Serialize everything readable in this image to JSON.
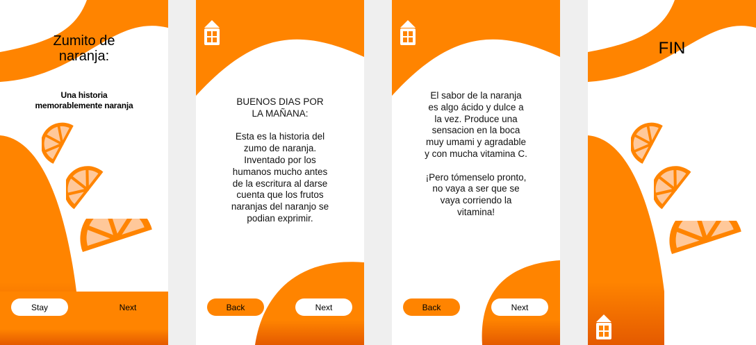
{
  "colors": {
    "accent": "#ff8400",
    "accent_dark": "#e45a00",
    "slice_fill": "#ffc89a",
    "background": "#efefef",
    "screen": "#ffffff"
  },
  "screens": [
    {
      "title": "Zumito de naranja:",
      "subtitle": "Una historia memorablemente naranja",
      "left_button": "Stay",
      "right_button": "Next"
    },
    {
      "text": "BUENOS DIAS POR LA MAÑANA:\n\nEsta es la historia del zumo de naranja. Inventado por los humanos mucho antes de la escritura al darse cuenta que los frutos naranjas del naranjo se podian exprimir.",
      "left_button": "Back",
      "right_button": "Next",
      "home_icon": "home-icon"
    },
    {
      "text": "El sabor de la naranja es algo ácido y dulce a la vez. Produce una sensacion en la boca muy umami y agradable y con mucha vitamina C.\n\n¡Pero tómenselo pronto, no vaya a ser que se vaya corriendo la vitamina!",
      "left_button": "Back",
      "right_button": "Next",
      "home_icon": "home-icon"
    },
    {
      "title": "FIN",
      "home_icon": "home-icon"
    }
  ]
}
